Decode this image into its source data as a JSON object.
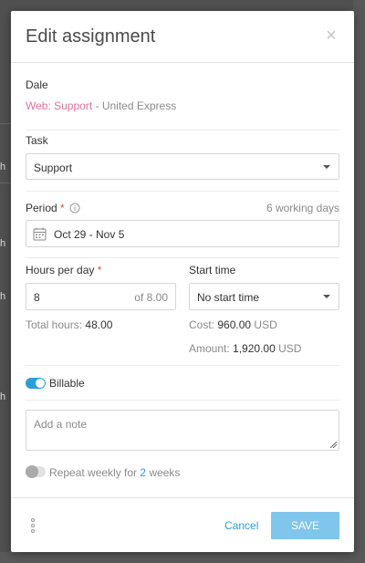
{
  "dialog": {
    "title": "Edit assignment"
  },
  "assignee": {
    "name": "Dale",
    "project": "Web: Support",
    "client": " - United Express"
  },
  "task": {
    "label": "Task",
    "value": "Support"
  },
  "period": {
    "label": "Period",
    "required_mark": "*",
    "working_days": "6 working days",
    "value": "Oct 29 - Nov 5"
  },
  "hours": {
    "label": "Hours per day",
    "required_mark": "*",
    "value": "8",
    "of_text": "of 8.00",
    "total_label": "Total hours:",
    "total_value": "48.00"
  },
  "start_time": {
    "label": "Start time",
    "value": "No start time"
  },
  "cost": {
    "label": "Cost:",
    "value": "960.00",
    "currency": "USD"
  },
  "amount": {
    "label": "Amount:",
    "value": "1,920.00",
    "currency": "USD"
  },
  "billable": {
    "label": "Billable",
    "enabled": true
  },
  "note": {
    "placeholder": "Add a note"
  },
  "repeat": {
    "prefix": "Repeat weekly for",
    "count": "2",
    "suffix": "weeks",
    "enabled": false
  },
  "footer": {
    "cancel_label": "Cancel",
    "save_label": "SAVE"
  },
  "background": {
    "row_letter": "h"
  },
  "colors": {
    "accent": "#2a9fd8",
    "project": "#e2709c",
    "required": "#e84a4a",
    "save_button": "#7fc5ec"
  }
}
